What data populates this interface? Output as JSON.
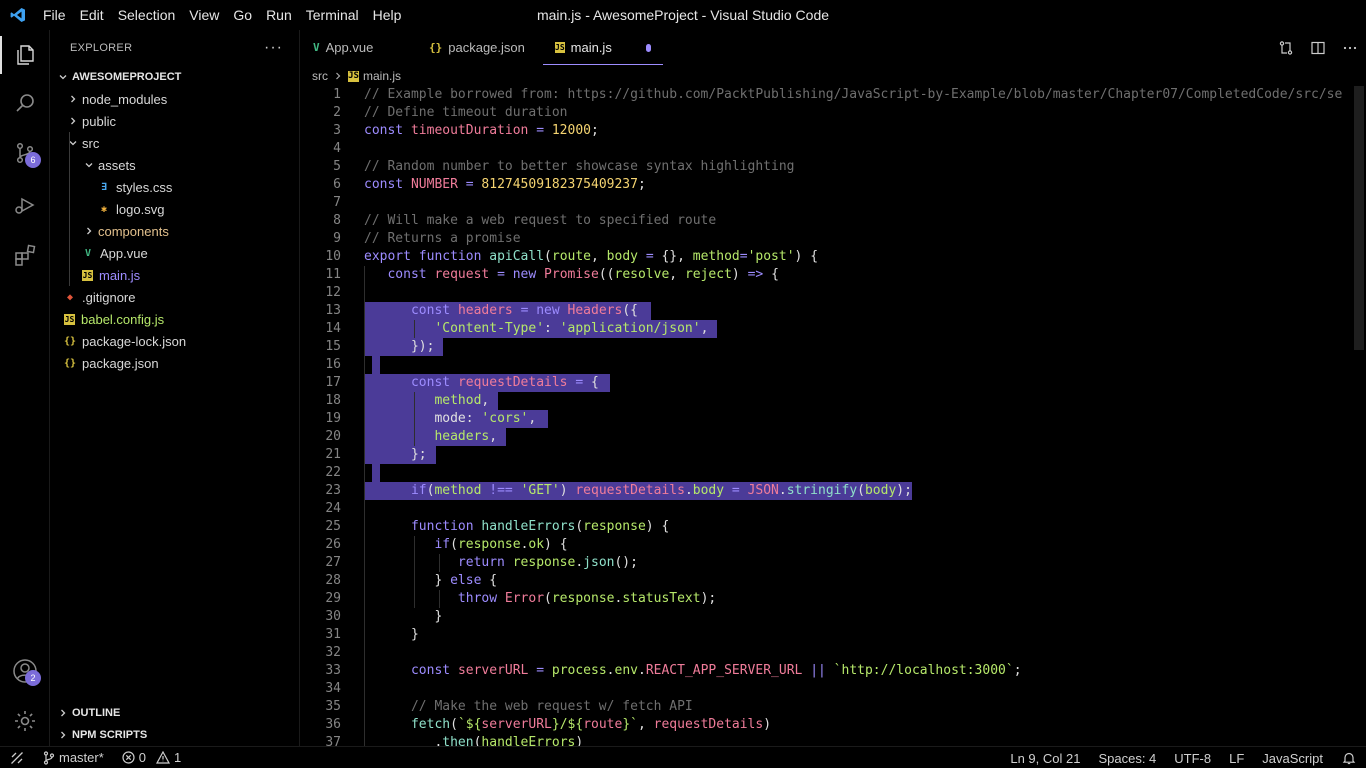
{
  "window": {
    "title": "main.js - AwesomeProject - Visual Studio Code"
  },
  "menu": [
    "File",
    "Edit",
    "Selection",
    "View",
    "Go",
    "Run",
    "Terminal",
    "Help"
  ],
  "activity": {
    "scm_badge": "6",
    "account_badge": "2"
  },
  "explorer": {
    "title": "EXPLORER",
    "more": "···",
    "project": "AWESOMEPROJECT",
    "items": [
      {
        "label": "node_modules",
        "type": "folder"
      },
      {
        "label": "public",
        "type": "folder"
      },
      {
        "label": "src",
        "type": "folder-open"
      },
      {
        "label": "assets",
        "type": "folder-open"
      },
      {
        "label": "styles.css",
        "type": "css"
      },
      {
        "label": "logo.svg",
        "type": "svg"
      },
      {
        "label": "components",
        "type": "folder"
      },
      {
        "label": "App.vue",
        "type": "vue"
      },
      {
        "label": "main.js",
        "type": "js"
      },
      {
        "label": ".gitignore",
        "type": "git"
      },
      {
        "label": "babel.config.js",
        "type": "js"
      },
      {
        "label": "package-lock.json",
        "type": "json"
      },
      {
        "label": "package.json",
        "type": "json"
      }
    ],
    "outline": "OUTLINE",
    "npm_scripts": "NPM SCRIPTS"
  },
  "tabs": [
    {
      "label": "App.vue",
      "icon": "vue"
    },
    {
      "label": "package.json",
      "icon": "json"
    },
    {
      "label": "main.js",
      "icon": "js",
      "active": true,
      "dirty": true
    }
  ],
  "breadcrumb": {
    "folder": "src",
    "file": "main.js"
  },
  "colors": {
    "accent": "#9d8cff",
    "selection": "#4b3b98",
    "badge": "#7b6cd9"
  },
  "statusbar": {
    "branch": "master*",
    "errors": "0",
    "warnings": "1",
    "position": "Ln 9, Col 21",
    "spaces": "Spaces: 4",
    "encoding": "UTF-8",
    "eol": "LF",
    "language": "JavaScript"
  },
  "code_lines": [
    "1",
    "2",
    "3",
    "4",
    "5",
    "6",
    "7",
    "8",
    "9",
    "10",
    "11",
    "12",
    "13",
    "14",
    "15",
    "16",
    "17",
    "18",
    "19",
    "20",
    "21",
    "22",
    "23",
    "24",
    "25",
    "26",
    "27",
    "28",
    "29",
    "30",
    "31",
    "32",
    "33",
    "34",
    "35",
    "36",
    "37"
  ]
}
